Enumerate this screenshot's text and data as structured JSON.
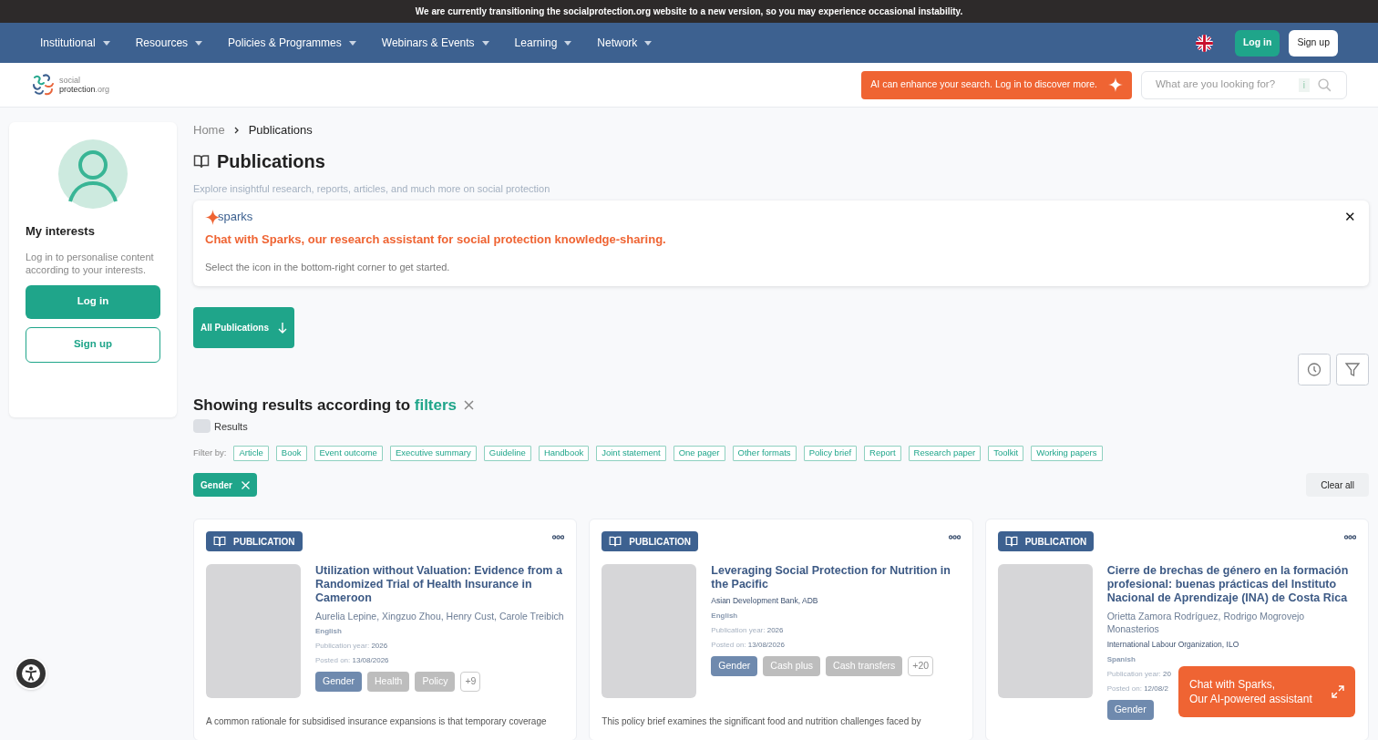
{
  "banner": "We are currently transitioning the socialprotection.org website to a new version, so you may experience occasional instability.",
  "nav": {
    "items": [
      "Institutional",
      "Resources",
      "Policies & Programmes",
      "Webinars & Events",
      "Learning",
      "Network"
    ],
    "login": "Log in",
    "signup": "Sign up"
  },
  "header": {
    "logo_top": "social",
    "logo_bottom": "protection",
    "logo_suffix": ".org",
    "ai_banner": "AI can enhance your search. Log in to discover more.",
    "search": {
      "placeholder": "What are you looking for?",
      "info": "i"
    }
  },
  "sidebar": {
    "title": "My interests",
    "text": "Log in to personalise content according to your interests.",
    "login": "Log in",
    "signup": "Sign up"
  },
  "breadcrumb": [
    {
      "label": "Home",
      "selected": false
    },
    {
      "label": "Publications",
      "selected": true
    }
  ],
  "page": {
    "title": "Publications",
    "subtitle": "Explore insightful research, reports, articles, and much more on social protection"
  },
  "sparks": {
    "logo": "sparks",
    "headline": "Chat with Sparks, our research assistant for social protection knowledge-sharing.",
    "text": "Select the icon in the bottom-right corner to get started.",
    "close": "✕"
  },
  "all_button": "All Publications",
  "results": {
    "heading": "Showing results according to ",
    "heading_link": "filters",
    "toggle_label": "Results",
    "toggle_on": false,
    "filter_by": "Filter by:",
    "filters": [
      "Article",
      "Book",
      "Event outcome",
      "Executive summary",
      "Guideline",
      "Handbook",
      "Joint statement",
      "One pager",
      "Other formats",
      "Policy brief",
      "Report",
      "Research paper",
      "Toolkit",
      "Working papers"
    ],
    "active": [
      "Gender"
    ],
    "clear": "Clear all"
  },
  "cards": [
    {
      "badge": "PUBLICATION",
      "title": "Utilization without Valuation: Evidence from a Randomized Trial of Health Insurance in Cameroon",
      "authors": "Aurelia Lepine, Xingzuo Zhou, Henry Cust, Carole Treibich",
      "language": "English",
      "year_label": "Publication year:",
      "year": "2026",
      "posted_label": "Posted on:",
      "posted": "13/08/2026",
      "tags": [
        {
          "label": "Gender",
          "kind": "primary"
        },
        {
          "label": "Health",
          "kind": "secondary"
        },
        {
          "label": "Policy",
          "kind": "secondary"
        },
        {
          "label": "+9",
          "kind": "more"
        }
      ],
      "excerpt": "A common rationale for subsidised insurance expansions is that temporary coverage"
    },
    {
      "badge": "PUBLICATION",
      "title": "Leveraging Social Protection for Nutrition in the Pacific",
      "org": "Asian Development Bank, ADB",
      "language": "English",
      "year_label": "Publication year:",
      "year": "2026",
      "posted_label": "Posted on:",
      "posted": "13/08/2026",
      "tags": [
        {
          "label": "Gender",
          "kind": "primary"
        },
        {
          "label": "Cash plus",
          "kind": "secondary"
        },
        {
          "label": "Cash transfers",
          "kind": "secondary"
        },
        {
          "label": "+20",
          "kind": "more"
        }
      ],
      "excerpt": "This policy brief examines the significant food and nutrition challenges faced by"
    },
    {
      "badge": "PUBLICATION",
      "title": "Cierre de brechas de género en la formación profesional: buenas prácticas del Instituto Nacional de Aprendizaje (INA) de Costa Rica",
      "authors": "Orietta Zamora Rodríguez, Rodrigo Mogrovejo Monasterios",
      "org": "International Labour Organization, ILO",
      "language": "Spanish",
      "year_label": "Publication year:",
      "year": "20",
      "posted_label": "Posted on:",
      "posted": "12/08/2",
      "tags": [
        {
          "label": "Gender",
          "kind": "primary"
        }
      ]
    }
  ],
  "chat_widget": {
    "line1": "Chat with Sparks,",
    "line2": "Our AI-powered assistant"
  }
}
